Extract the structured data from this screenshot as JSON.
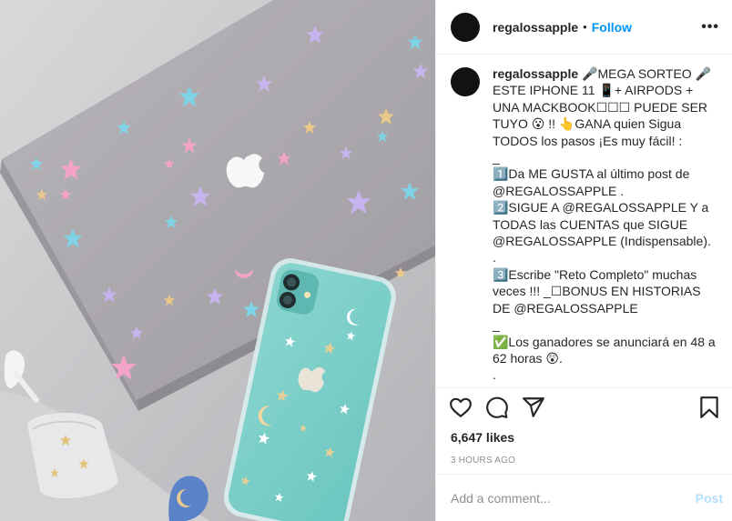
{
  "header": {
    "username": "regalossapple",
    "separator": "•",
    "follow_label": "Follow",
    "more_label": "•••"
  },
  "avatar": {
    "glyph": ""
  },
  "caption": {
    "username": "regalossapple",
    "text": " 🎤MEGA SORTEO 🎤 ESTE IPHONE 11 📱+ AIRPODS + UNA MACKBOOK☐☐☐ PUEDE SER TUYO 😮 !! 👆GANA quien Sigua TODOS los pasos ¡Es muy fácil! :\n_\n1️⃣Da ME GUSTA al último post de @REGALOSSAPPLE .\n2️⃣SIGUE A @REGALOSSAPPLE Y a TODAS las CUENTAS que SIGUE @REGALOSSAPPLE (Indispensable).\n.\n3️⃣Escribe \"Reto Completo\" muchas veces !!! _☐BONUS EN HISTORIAS DE @REGALOSSAPPLE\n_\n✅Los ganadores se anunciará en 48 a 62 horas 😲.\n.\n¡Suerteeeee!"
  },
  "actions": {
    "like_icon": "heart-icon",
    "comment_icon": "comment-icon",
    "share_icon": "share-icon",
    "save_icon": "bookmark-icon"
  },
  "likes": "6,647 likes",
  "timestamp": "3 HOURS AGO",
  "comment": {
    "placeholder": "Add a comment...",
    "post_label": "Post"
  },
  "colors": {
    "follow": "#0095f6",
    "post_disabled": "#b2dffc",
    "muted": "#8e8e8e",
    "text": "#262626"
  }
}
